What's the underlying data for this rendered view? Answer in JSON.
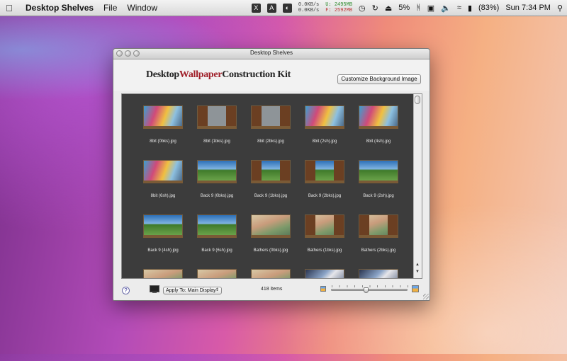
{
  "menubar": {
    "app_name": "Desktop Shelves",
    "menus": [
      "File",
      "Window"
    ],
    "status": {
      "net_tx": "0.0KB/s",
      "net_rx": "0.0KB/s",
      "mem_used": "U: 2495MB",
      "mem_free": "F: 2592MB",
      "cpu": "5%",
      "battery": "(83%)",
      "clock": "Sun 7:34 PM"
    }
  },
  "window": {
    "title": "Desktop Shelves",
    "kit_title_part1": "Desktop",
    "kit_title_accent": "Wallpaper",
    "kit_title_part2": "Construction Kit",
    "customize_button": "Customize Background Image",
    "items": [
      {
        "caption": "8bit (0bks).jpg",
        "thumb": "graffiti"
      },
      {
        "caption": "8bit (1bks).jpg",
        "thumb": "doors"
      },
      {
        "caption": "8bit (2bks).jpg",
        "thumb": "doors"
      },
      {
        "caption": "8bit (2sh).jpg",
        "thumb": "graffiti"
      },
      {
        "caption": "8bit (4sh).jpg",
        "thumb": "graffiti"
      },
      {
        "caption": "8bit (6sh).jpg",
        "thumb": "graffiti"
      },
      {
        "caption": "Back 9 (0bks).jpg",
        "thumb": "field"
      },
      {
        "caption": "Back 9 (1bks).jpg",
        "thumb": "field-doors"
      },
      {
        "caption": "Back 9 (2bks).jpg",
        "thumb": "field-doors"
      },
      {
        "caption": "Back 9 (2sh).jpg",
        "thumb": "field"
      },
      {
        "caption": "Back 9 (4sh).jpg",
        "thumb": "field"
      },
      {
        "caption": "Back 9 (6sh).jpg",
        "thumb": "field"
      },
      {
        "caption": "Bathers (0bks).jpg",
        "thumb": "bathers"
      },
      {
        "caption": "Bathers (1bks).jpg",
        "thumb": "bathers-doors"
      },
      {
        "caption": "Bathers (2bks).jpg",
        "thumb": "bathers-doors"
      },
      {
        "caption": "",
        "thumb": "bathers"
      },
      {
        "caption": "",
        "thumb": "bathers"
      },
      {
        "caption": "",
        "thumb": "bathers"
      },
      {
        "caption": "",
        "thumb": "stripes"
      },
      {
        "caption": "",
        "thumb": "stripes"
      }
    ],
    "footer": {
      "help_label": "?",
      "apply_select_value": "Apply To: Main Display",
      "item_count": "418 items",
      "thumbnail_size_level": 0.45
    }
  }
}
